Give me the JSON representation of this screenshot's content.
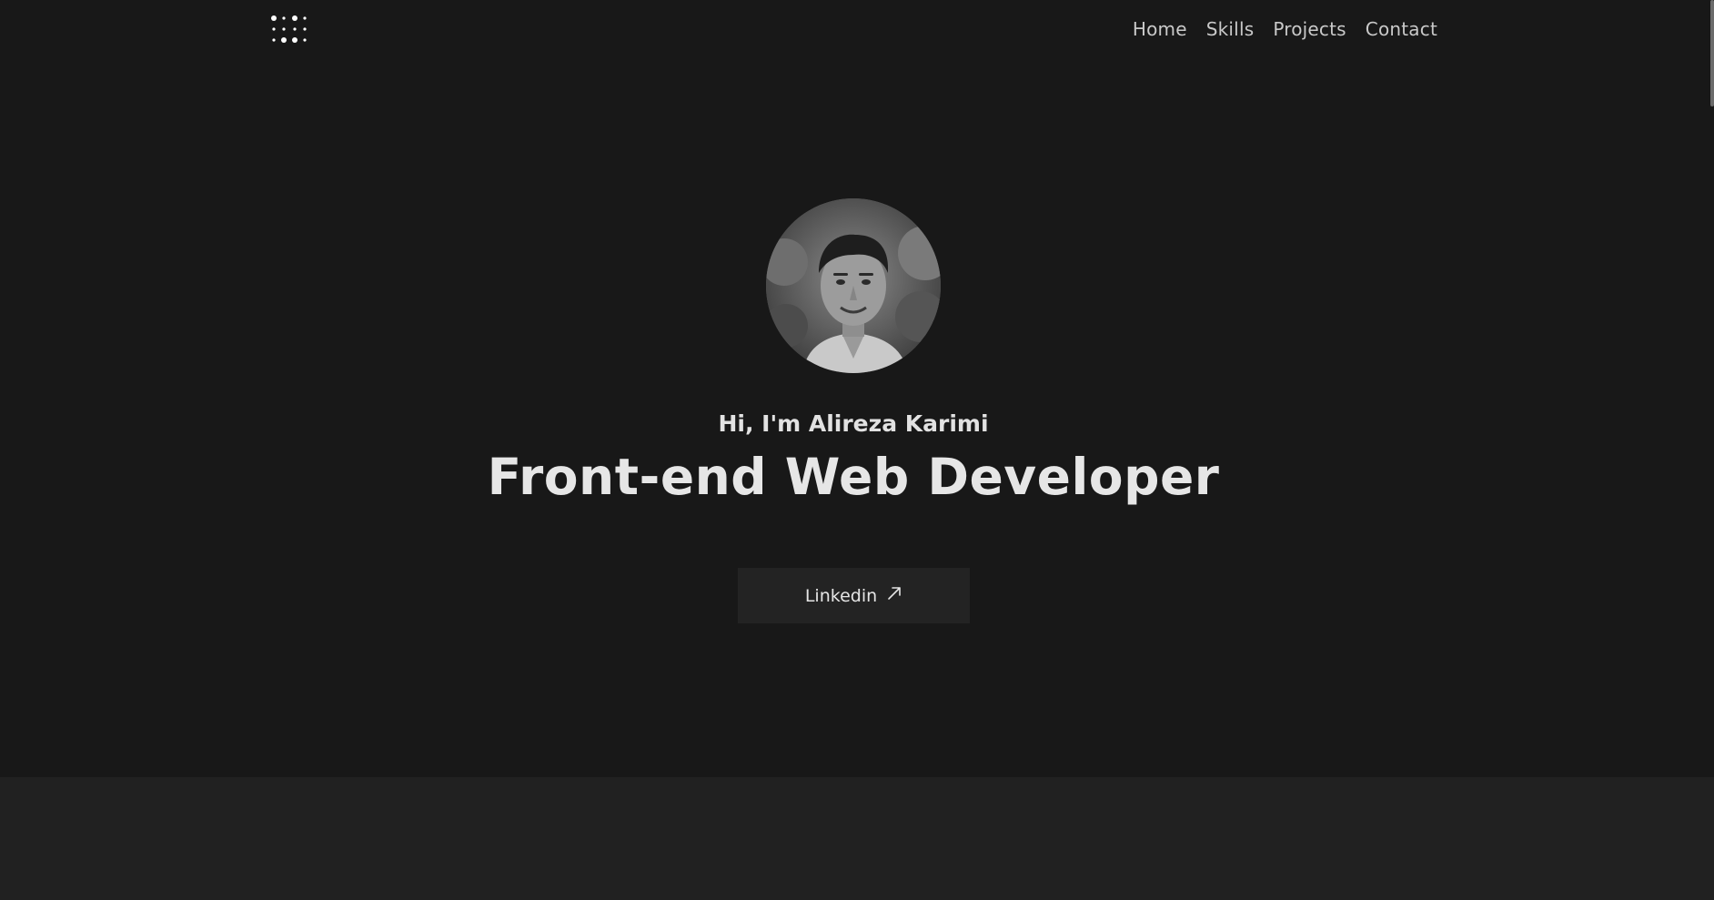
{
  "nav": {
    "items": [
      {
        "label": "Home"
      },
      {
        "label": "Skills"
      },
      {
        "label": "Projects"
      },
      {
        "label": "Contact"
      }
    ]
  },
  "hero": {
    "greeting": "Hi, I'm Alireza Karimi",
    "title": "Front-end Web Developer",
    "linkedin_label": "Linkedin",
    "linkedin_icon": "arrow-up-right-icon"
  },
  "logo": {
    "icon": "dots-grid-logo"
  },
  "colors": {
    "background": "#181818",
    "lower_section": "#212121",
    "button_bg": "#232323",
    "text": "#e6e6e6",
    "nav_text": "#c9c9c9"
  }
}
